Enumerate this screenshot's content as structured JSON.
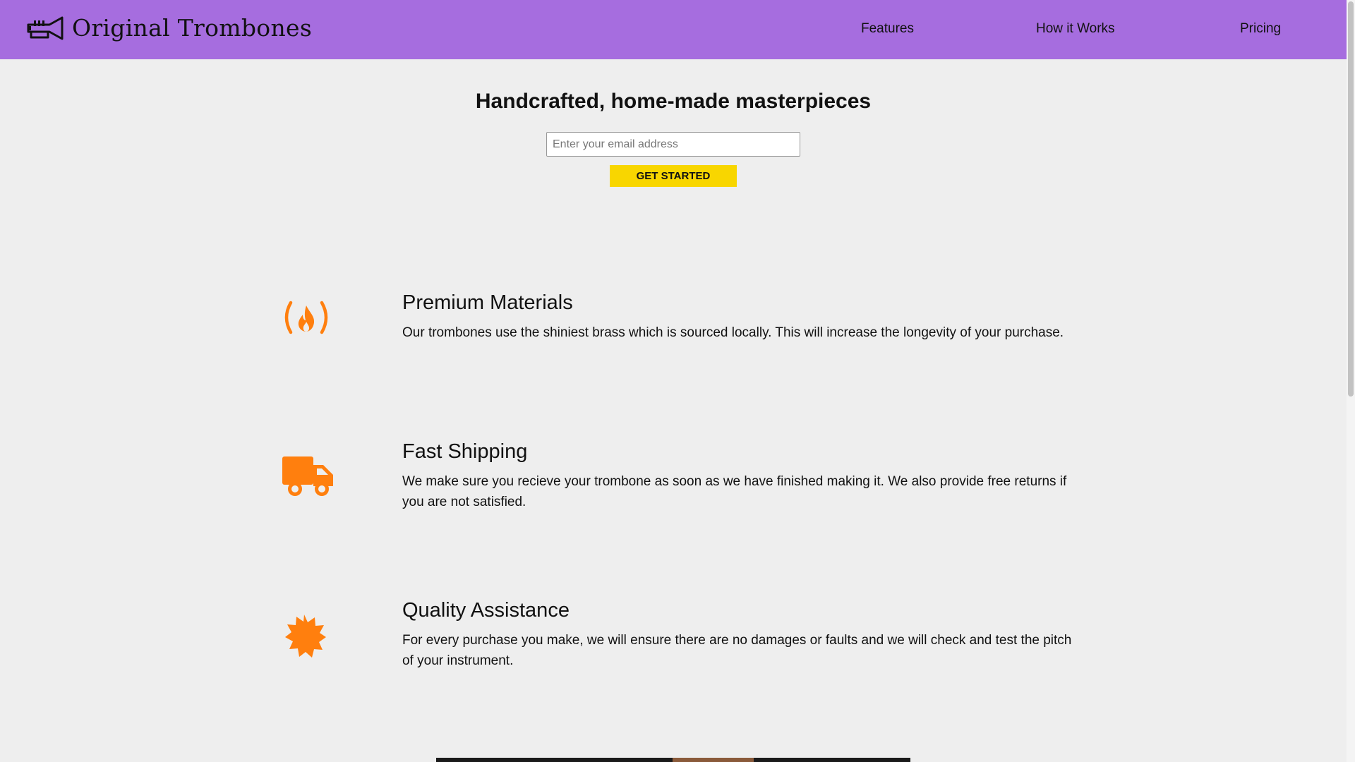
{
  "header": {
    "brand": "Original Trombones",
    "nav": [
      {
        "label": "Features"
      },
      {
        "label": "How it Works"
      },
      {
        "label": "Pricing"
      }
    ]
  },
  "hero": {
    "title": "Handcrafted, home-made masterpieces",
    "email_placeholder": "Enter your email address",
    "cta_label": "GET STARTED"
  },
  "features": [
    {
      "icon": "fire-icon",
      "title": "Premium Materials",
      "description": "Our trombones use the shiniest brass which is sourced locally. This will increase the longevity of your purchase."
    },
    {
      "icon": "truck-icon",
      "title": "Fast Shipping",
      "description": "We make sure you recieve your trombone as soon as we have finished making it. We also provide free returns if you are not satisfied."
    },
    {
      "icon": "badge-icon",
      "title": "Quality Assistance",
      "description": "For every purchase you make, we will ensure there are no damages or faults and we will check and test the pitch of your instrument."
    }
  ],
  "colors": {
    "header_bg": "#a66ddf",
    "page_bg": "#eeeeee",
    "cta_bg": "#f8d600",
    "icon_accent": "#ff7f0e"
  }
}
